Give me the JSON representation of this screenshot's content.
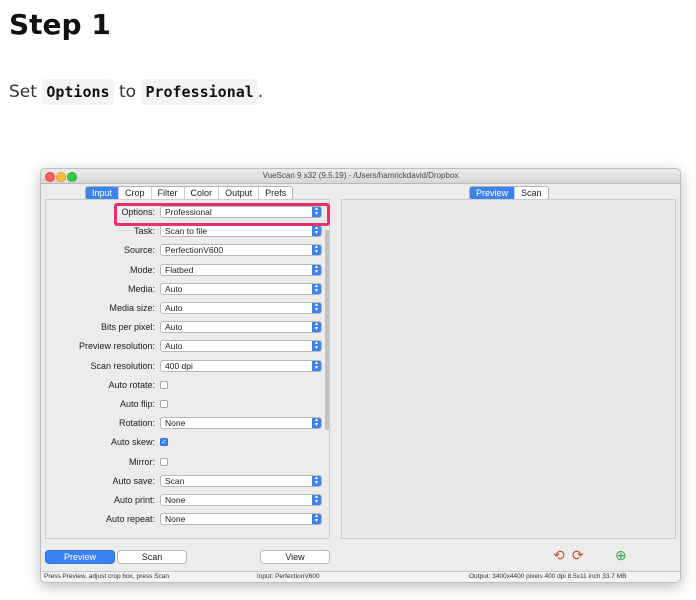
{
  "page": {
    "step_title": "Step 1",
    "instruction": {
      "prefix": "Set",
      "code1": "Options",
      "middle": "to",
      "code2": "Professional",
      "suffix": "."
    }
  },
  "window": {
    "title": "VueScan 9 x32 (9.5.19) - /Users/hamrickdavid/Dropbox",
    "left_tabs": [
      "Input",
      "Crop",
      "Filter",
      "Color",
      "Output",
      "Prefs"
    ],
    "left_active_tab": "Input",
    "right_tabs": [
      "Preview",
      "Scan"
    ],
    "right_active_tab": "Preview",
    "settings": [
      {
        "label": "Options:",
        "type": "select",
        "value": "Professional"
      },
      {
        "label": "Task:",
        "type": "select",
        "value": "Scan to file"
      },
      {
        "label": "Source:",
        "type": "select",
        "value": "PerfectionV600"
      },
      {
        "label": "Mode:",
        "type": "select",
        "value": "Flatbed"
      },
      {
        "label": "Media:",
        "type": "select",
        "value": "Auto"
      },
      {
        "label": "Media size:",
        "type": "select",
        "value": "Auto"
      },
      {
        "label": "Bits per pixel:",
        "type": "select",
        "value": "Auto"
      },
      {
        "label": "Preview resolution:",
        "type": "select",
        "value": "Auto"
      },
      {
        "label": "Scan resolution:",
        "type": "select",
        "value": "400 dpi"
      },
      {
        "label": "Auto rotate:",
        "type": "checkbox",
        "checked": false
      },
      {
        "label": "Auto flip:",
        "type": "checkbox",
        "checked": false
      },
      {
        "label": "Rotation:",
        "type": "select",
        "value": "None"
      },
      {
        "label": "Auto skew:",
        "type": "checkbox",
        "checked": true
      },
      {
        "label": "Mirror:",
        "type": "checkbox",
        "checked": false
      },
      {
        "label": "Auto save:",
        "type": "select",
        "value": "Scan"
      },
      {
        "label": "Auto print:",
        "type": "select",
        "value": "None"
      },
      {
        "label": "Auto repeat:",
        "type": "select",
        "value": "None"
      }
    ],
    "buttons": {
      "preview": "Preview",
      "scan": "Scan",
      "view": "View"
    },
    "status": {
      "left": "Press Preview, adjust crop box, press Scan",
      "middle": "Input: PerfectionV600",
      "right": "Output: 3400x4400 pixels 400 dpi 8.5x11 inch 33.7 MB"
    },
    "colors": {
      "accent": "#3c82f0",
      "highlight": "#e7316e"
    }
  }
}
